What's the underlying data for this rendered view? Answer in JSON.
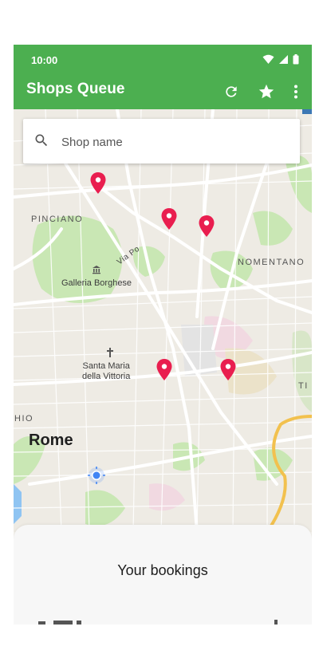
{
  "status_bar": {
    "time": "10:00"
  },
  "app_bar": {
    "title": "Shops Queue",
    "actions": [
      {
        "name": "refresh-icon"
      },
      {
        "name": "star-icon"
      },
      {
        "name": "more-vert-icon"
      }
    ]
  },
  "search": {
    "placeholder": "Shop name",
    "icon": "search-icon"
  },
  "map": {
    "labels": {
      "pinciano": "PINCIANO",
      "nomentano": "NOMENTANO",
      "via_po": "Via Po",
      "galleria": "Galleria Borghese",
      "santa_maria": "Santa Maria\ndella Vittoria",
      "rome": "Rome",
      "hio": "HIO",
      "ti": "TI"
    },
    "marker_color": "#e91e4f",
    "road_color": "#ffffff",
    "park_color": "#c9e7b4",
    "highway_color": "#f2c14e"
  },
  "bottom_sheet": {
    "title": "Your bookings"
  },
  "colors": {
    "primary": "#4caf50",
    "on_primary": "#ffffff"
  }
}
